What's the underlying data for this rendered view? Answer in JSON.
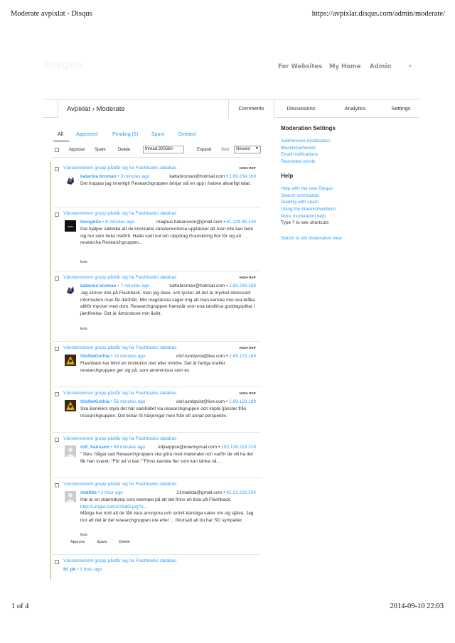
{
  "print_header": {
    "title": "Moderate avpixlat - Disqus",
    "url": "https://avpixlat.disqus.com/admin/moderate/"
  },
  "print_footer": {
    "page": "1 of 4",
    "datetime": "2014-09-10 22:03"
  },
  "brand": {
    "logo_text": "DISQUS"
  },
  "topnav": {
    "websites": "For Websites",
    "home": "My Home",
    "admin": "Admin",
    "more": "•"
  },
  "breadcrumb": "Avpixlat › Moderate",
  "tabs": {
    "comments": "Comments",
    "discussions": "Discussions",
    "analytics": "Analytics",
    "settings": "Settings"
  },
  "filters": {
    "all": "All",
    "approved": "Approved",
    "pending": "Pending (6)",
    "spam": "Spam",
    "deleted": "Deleted"
  },
  "bulk": {
    "approve": "Approve",
    "spam": "Spam",
    "delete": "Delete",
    "search_value": "thread:300560-",
    "expand": "Expand",
    "sort_label": "Sort",
    "sort_value": "Newest"
  },
  "comments": [
    {
      "thread": "Vänsterextrem grupp påstår sig ha Flashbacks databas",
      "high_rep": "HIGH REP",
      "author": "katarina broman",
      "time": " • 3 minutes ago",
      "email": "kattabroman@hotmail.com • ",
      "ip": "2.69.234.188",
      "body": "Det hoppas jag innerligt! Researchgruppen börjar stå en upp i halsen allvarligt talat.",
      "link": "",
      "body2": "",
      "less": ""
    },
    {
      "thread": "Vänsterextrem grupp påstår sig ha Flashbacks databas",
      "high_rep": "",
      "author": "Incognito",
      "time": " • 6 minutes ago",
      "email": "magnus.hakansson@gmail.com • ",
      "ip": "81.229.46.149",
      "body": "Det hjälper sällvidla att de kriminella vänsterextrema upptäcker att man inte kan bete sig hur som helst riskfritt. Hade varit kul om Uppdrag Granskning fick för sig att researcha Researchgruppen...",
      "link": "",
      "body2": "",
      "less": "less"
    },
    {
      "thread": "Vänsterextrem grupp påstår sig ha Flashbacks databas",
      "high_rep": "HIGH REP",
      "author": "katarina broman",
      "time": " • 7 minutes ago",
      "email": "kattabroman@hotmail.com • ",
      "ip": "2.69.234.188",
      "body": "Jag skriver inte på Flashback, men jag läser, och tycker att det är mycket intressant information man får därifrån. Min magkänsla säger mig att man kanske inte ska bråka alltför mycket med dom. Researchgruppen framstår som ena tandlösa goddagspiltar i jämförelse. Det är åtminstone min åsikt.",
      "link": "",
      "body2": "",
      "less": "less"
    },
    {
      "thread": "Vänsterextrem grupp påstår sig ha Flashbacks databas",
      "high_rep": "HIGH REP",
      "author": "OlofdeGothia",
      "time": " • 15 minutes ago",
      "email": "olof.lundqvist@live.com • ",
      "ip": "2.69.123.199",
      "body": "Flashback har blivit en institution mer eller mindre. Det är farliga krafter researchgruppen ger sig på. som anominious som ex",
      "link": "",
      "body2": "",
      "less": ""
    },
    {
      "thread": "Vänsterextrem grupp påstår sig ha Flashbacks databas",
      "high_rep": "HIGH REP",
      "author": "OlofdeGothia",
      "time": " • 56 minutes ago",
      "email": "olof.lundqvist@live.com • ",
      "ip": "2.69.123.199",
      "body": "Ska Bonniers styra det här samhället via researchgruppen och köpta tjänster från researchgruppen, Det liknar IS härjningar men från ett annat perspektiv.",
      "link": "",
      "body2": "",
      "less": ""
    },
    {
      "thread": "Vänsterextrem grupp påstår sig ha Flashbacks databas",
      "high_rep": "",
      "author": "rolf_hansson",
      "time": " • 58 minutes ago",
      "email": "kdjiaqrpce@nowmymail.com • ",
      "ip": "193.138.219.229",
      "body": "\" Neo, frågar vad Researchgruppen ska göra med materialet och varför de vill ha det får han svaret: \"För att vi kan.\"\"Finns kanske fler som kan tänka så...",
      "link": "",
      "body2": "",
      "less": ""
    },
    {
      "thread": "Vänsterextrem grupp påstår sig ha Flashbacks databas",
      "high_rep": "",
      "author": "matilda",
      "time": " • 1 hour ago",
      "email": "21matilda@gmail.com • ",
      "ip": "81.21.216.254",
      "body": "Här är en skärmdump som exempel på att det finns en lista på Flashback.",
      "link": "http://i.imgur.com/oYkdG.jpg?1...",
      "body2": "Många har trott att de fått vara anonyma och skrivit känsliga saker om sig själva. Jag tror att det är det researchgruppen ute efter ... förutsatt att du har SD sympatier.",
      "less": "less",
      "actions": {
        "approve": "Approve",
        "spam": "Spam",
        "delete": "Delete"
      }
    },
    {
      "thread": "Vänsterextrem grupp påstår sig ha Flashbacks databas",
      "high_rep": "",
      "author": "fd_pk",
      "time": " • 1 hour ago",
      "email": "",
      "ip": "",
      "body": "",
      "link": "",
      "body2": "",
      "less": ""
    }
  ],
  "sidebar": {
    "moderation_title": "Moderation Settings",
    "mod_links": [
      "Add/remove moderators",
      "Blacklist/whitelist",
      "Email notifications",
      "Restricted words"
    ],
    "help_title": "Help",
    "help_links": [
      "Help with the new Disqus",
      "Search commands",
      "Dealing with spam",
      "Using the blacklist/whitelist",
      "More moderation help"
    ],
    "shortcut_text": "Type  ?  to see shortcuts",
    "old_view": "Switch to old moderation view"
  }
}
